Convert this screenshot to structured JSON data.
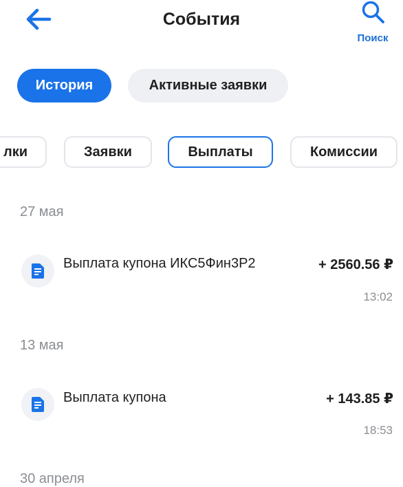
{
  "header": {
    "title": "События",
    "search_label": "Поиск"
  },
  "tabs": [
    {
      "label": "История",
      "active": true
    },
    {
      "label": "Активные заявки",
      "active": false
    }
  ],
  "filters": [
    "лки",
    "Заявки",
    "Выплаты",
    "Комиссии"
  ],
  "selected_filter": "Выплаты",
  "groups": [
    {
      "date": "27 мая",
      "items": [
        {
          "title": "Выплата купона ИКС5Фин3Р2",
          "amount": "+ 2560.56 ₽",
          "time": "13:02"
        }
      ]
    },
    {
      "date": "13 мая",
      "items": [
        {
          "title": "Выплата купона",
          "amount": "+ 143.85 ₽",
          "time": "18:53"
        }
      ]
    },
    {
      "date": "30 апреля",
      "items": []
    }
  ],
  "colors": {
    "accent": "#1a73e8",
    "muted": "#8a8d92",
    "chip_border": "#e3e5e9",
    "tab_bg": "#eef0f3"
  },
  "icons": {
    "back": "arrow-left-icon",
    "search": "search-icon",
    "event": "document-icon"
  }
}
